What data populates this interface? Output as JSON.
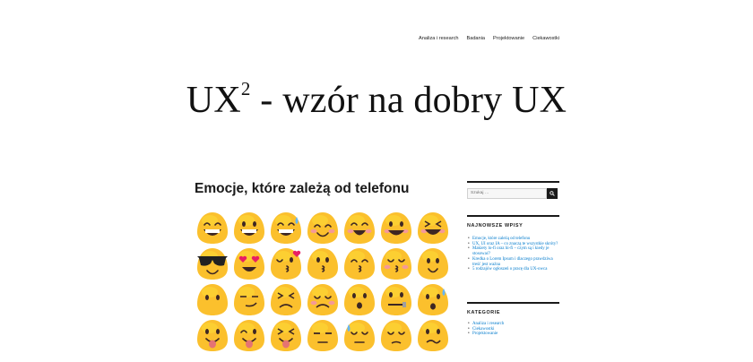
{
  "nav": {
    "items": [
      "Analiza i research",
      "Badania",
      "Projektowanie",
      "Ciekawostki"
    ]
  },
  "site": {
    "title_main": "UX",
    "title_sup": "2",
    "title_rest": " - wzór na dobry UX"
  },
  "post": {
    "title": "Emocje, które zależą od telefonu"
  },
  "sidebar": {
    "search_placeholder": "Szukaj …",
    "recent_title": "NAJNOWSZE WPISY",
    "recent_posts": [
      "Emocje, które zależą od telefonu",
      "UX, UI oraz IA – co znaczą te wszystkie skróty?",
      "Makiety lo-fi oraz hi-fi – czym są i kiedy je stosować?",
      "Kredka o Lorem Ipsum i dlaczego prawdziwa treść jest ważna",
      "5 rodzajów ogłoszeń o pracę dla UX-owca"
    ],
    "categories_title": "KATEGORIE",
    "categories": [
      "Analiza i research",
      "Ciekawostki",
      "Projektowanie"
    ]
  },
  "emoji": {
    "face_color": "#fbc02d",
    "face_highlight": "#fdd835",
    "features": "#3e2723",
    "blush": "#f48fb1",
    "heart": "#e91e63",
    "items": [
      "grin-squint",
      "grin-teeth",
      "laugh-sweat",
      "smile-blush",
      "grin-blush",
      "smile-happy",
      "laugh-squint",
      "sunglasses",
      "heart-eyes",
      "kiss-heart",
      "kiss",
      "kiss-closed",
      "kiss-blush",
      "slight-smile",
      "neutral",
      "smirk",
      "persevere",
      "tired",
      "open-mouth",
      "zipper",
      "surprised-sweat",
      "tongue",
      "wink-tongue",
      "squint-tongue",
      "unamused",
      "sweat",
      "pensive",
      "confused"
    ]
  }
}
